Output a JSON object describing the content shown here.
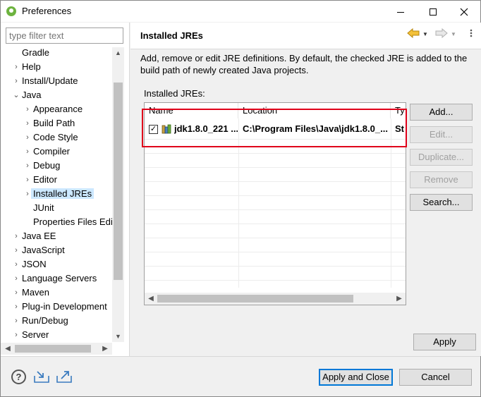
{
  "window": {
    "title": "Preferences"
  },
  "filter": {
    "placeholder": "type filter text"
  },
  "tree": {
    "items": [
      {
        "label": "Gradle",
        "arrow": ""
      },
      {
        "label": "Help",
        "arrow": "›"
      },
      {
        "label": "Install/Update",
        "arrow": "›"
      },
      {
        "label": "Java",
        "arrow": "⌄"
      },
      {
        "label": "Appearance",
        "arrow": "›"
      },
      {
        "label": "Build Path",
        "arrow": "›"
      },
      {
        "label": "Code Style",
        "arrow": "›"
      },
      {
        "label": "Compiler",
        "arrow": "›"
      },
      {
        "label": "Debug",
        "arrow": "›"
      },
      {
        "label": "Editor",
        "arrow": "›"
      },
      {
        "label": "Installed JREs",
        "arrow": "›"
      },
      {
        "label": "JUnit",
        "arrow": ""
      },
      {
        "label": "Properties Files Edit",
        "arrow": ""
      },
      {
        "label": "Java EE",
        "arrow": "›"
      },
      {
        "label": "JavaScript",
        "arrow": "›"
      },
      {
        "label": "JSON",
        "arrow": "›"
      },
      {
        "label": "Language Servers",
        "arrow": "›"
      },
      {
        "label": "Maven",
        "arrow": "›"
      },
      {
        "label": "Plug-in Development",
        "arrow": "›"
      },
      {
        "label": "Run/Debug",
        "arrow": "›"
      },
      {
        "label": "Server",
        "arrow": "›"
      }
    ]
  },
  "page": {
    "title": "Installed JREs",
    "description": "Add, remove or edit JRE definitions. By default, the checked JRE is added to the build path of newly created Java projects.",
    "list_label": "Installed JREs:"
  },
  "table": {
    "columns": [
      "Name",
      "Location",
      "Ty"
    ],
    "rows": [
      {
        "checked": "✓",
        "name": "jdk1.8.0_221 ...",
        "location": "C:\\Program Files\\Java\\jdk1.8.0_...",
        "type": "St"
      }
    ]
  },
  "buttons": {
    "add": "Add...",
    "edit": "Edit...",
    "duplicate": "Duplicate...",
    "remove": "Remove",
    "search": "Search...",
    "apply": "Apply",
    "apply_close": "Apply and Close",
    "cancel": "Cancel"
  },
  "icons": {
    "help": "?",
    "scroll_up": "▲",
    "scroll_down": "▼",
    "scroll_left": "◀",
    "scroll_right": "▶"
  },
  "colors": {
    "selection": "#cce8ff",
    "highlight_border": "#e0001a",
    "default_button_border": "#0078d7"
  }
}
